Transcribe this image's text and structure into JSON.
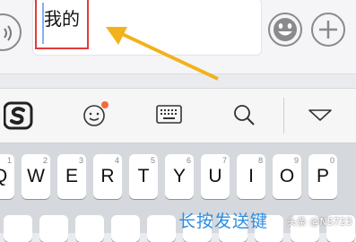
{
  "input": {
    "value": "我的"
  },
  "keyboard": {
    "row1": [
      {
        "letter": "Q",
        "number": "1"
      },
      {
        "letter": "W",
        "number": "2"
      },
      {
        "letter": "E",
        "number": "3"
      },
      {
        "letter": "R",
        "number": "4"
      },
      {
        "letter": "T",
        "number": "5"
      },
      {
        "letter": "Y",
        "number": "6"
      },
      {
        "letter": "U",
        "number": "7"
      },
      {
        "letter": "I",
        "number": "8"
      },
      {
        "letter": "O",
        "number": "9"
      },
      {
        "letter": "P",
        "number": "0"
      }
    ]
  },
  "annotation": {
    "caption": "长按发送键",
    "watermark": "头条 @NS723"
  },
  "icons": {
    "voice": "voice-icon",
    "emoji": "emoji-icon",
    "plus": "plus-icon",
    "sogou": "sogou-logo-icon",
    "face": "face-icon",
    "keyboard": "keyboard-icon",
    "search": "search-icon",
    "collapse": "triangle-down-icon"
  },
  "colors": {
    "highlight": "#e23b3b",
    "arrow": "#f2b21b",
    "caption": "#2a8de0",
    "notify_dot": "#f26b3a"
  }
}
